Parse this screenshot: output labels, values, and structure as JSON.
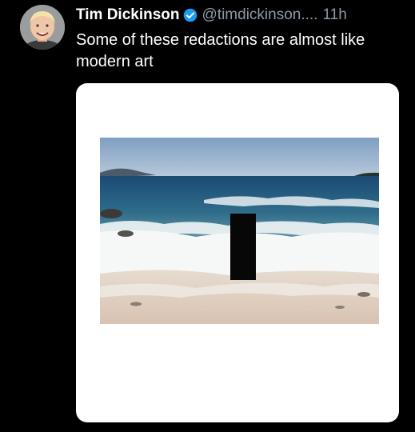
{
  "tweet": {
    "display_name": "Tim Dickinson",
    "handle": "@timdickinson....",
    "timestamp": "11h",
    "text": "Some of these redactions are almost like modern art",
    "verified": true
  },
  "colors": {
    "background": "#000000",
    "text": "#ffffff",
    "muted": "#8b98a5",
    "verified_badge": "#1d9bf0",
    "media_card": "#ffffff"
  },
  "icons": [
    "avatar-photo",
    "verified-badge-icon",
    "beach-photo",
    "redaction-block"
  ]
}
